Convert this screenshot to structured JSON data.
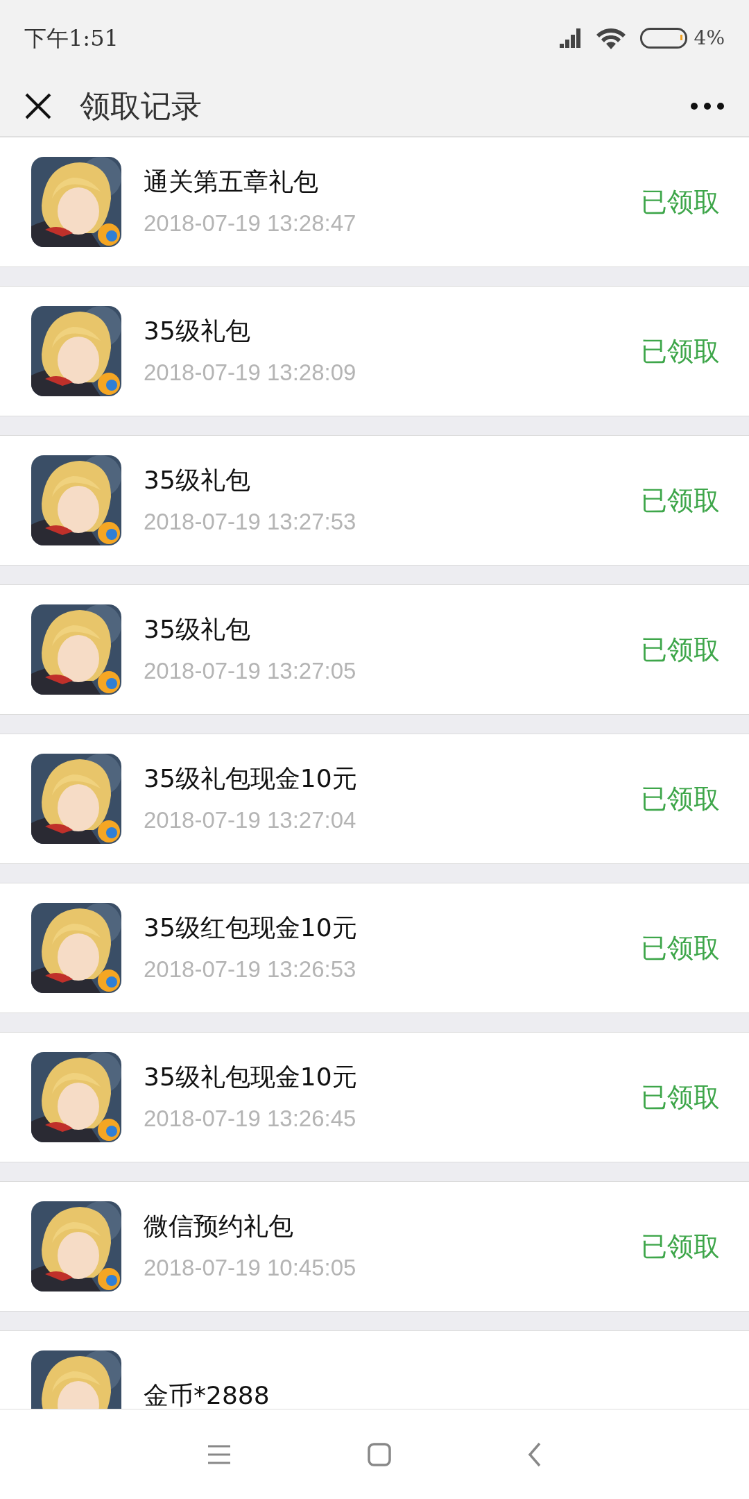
{
  "status_bar": {
    "time": "下午1:51",
    "battery": "4%"
  },
  "header": {
    "title": "领取记录"
  },
  "records": [
    {
      "title": "通关第五章礼包",
      "time": "2018-07-19 13:28:47",
      "status": "已领取"
    },
    {
      "title": "35级礼包",
      "time": "2018-07-19 13:28:09",
      "status": "已领取"
    },
    {
      "title": "35级礼包",
      "time": "2018-07-19 13:27:53",
      "status": "已领取"
    },
    {
      "title": "35级礼包",
      "time": "2018-07-19 13:27:05",
      "status": "已领取"
    },
    {
      "title": "35级礼包现金10元",
      "time": "2018-07-19 13:27:04",
      "status": "已领取"
    },
    {
      "title": "35级红包现金10元",
      "time": "2018-07-19 13:26:53",
      "status": "已领取"
    },
    {
      "title": "35级礼包现金10元",
      "time": "2018-07-19 13:26:45",
      "status": "已领取"
    },
    {
      "title": "微信预约礼包",
      "time": "2018-07-19 10:45:05",
      "status": "已领取"
    },
    {
      "title": "金币*2888"
    }
  ]
}
